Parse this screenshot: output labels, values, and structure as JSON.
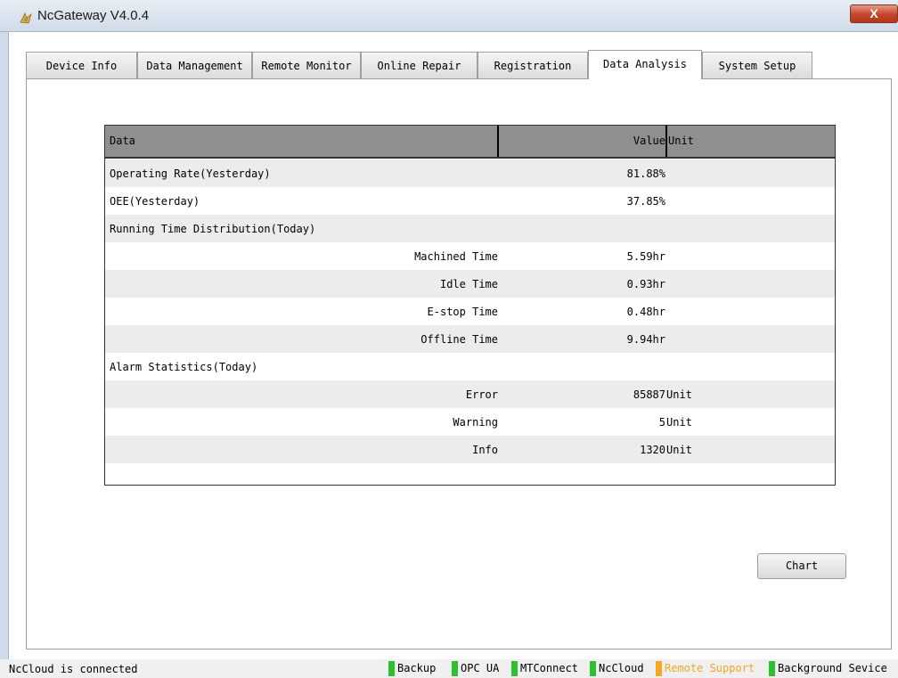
{
  "window": {
    "title": "NcGateway V4.0.4",
    "close_label": "X"
  },
  "tabs": [
    {
      "label": "Device Info"
    },
    {
      "label": "Data Management"
    },
    {
      "label": "Remote Monitor"
    },
    {
      "label": "Online Repair"
    },
    {
      "label": "Registration"
    },
    {
      "label": "Data Analysis",
      "active": true
    },
    {
      "label": "System Setup"
    }
  ],
  "table": {
    "headers": {
      "data": "Data",
      "value": "Value",
      "unit": "Unit"
    },
    "rows": [
      {
        "name": "Operating Rate(Yesterday)",
        "sub": "",
        "value": "81.88%",
        "unit": ""
      },
      {
        "name": "OEE(Yesterday)",
        "sub": "",
        "value": "37.85%",
        "unit": ""
      },
      {
        "name": "Running Time Distribution(Today)",
        "sub": "",
        "value": "",
        "unit": ""
      },
      {
        "name": "",
        "sub": "Machined Time",
        "value": "5.59hr",
        "unit": ""
      },
      {
        "name": "",
        "sub": "Idle Time",
        "value": "0.93hr",
        "unit": ""
      },
      {
        "name": "",
        "sub": "E-stop Time",
        "value": "0.48hr",
        "unit": ""
      },
      {
        "name": "",
        "sub": "Offline Time",
        "value": "9.94hr",
        "unit": ""
      },
      {
        "name": "Alarm Statistics(Today)",
        "sub": "",
        "value": "",
        "unit": ""
      },
      {
        "name": "",
        "sub": "Error",
        "value": "85887",
        "unit": "Unit"
      },
      {
        "name": "",
        "sub": "Warning",
        "value": "5",
        "unit": "Unit"
      },
      {
        "name": "",
        "sub": "Info",
        "value": "1320",
        "unit": "Unit"
      }
    ]
  },
  "chart_button": "Chart",
  "status": {
    "message": "NcCloud is connected",
    "services": [
      {
        "label": "Backup",
        "color": "#2fbf2f"
      },
      {
        "label": "OPC UA",
        "color": "#2fbf2f"
      },
      {
        "label": "MTConnect",
        "color": "#2fbf2f"
      },
      {
        "label": "NcCloud",
        "color": "#2fbf2f"
      },
      {
        "label": "Remote Support",
        "color": "#f5a623"
      },
      {
        "label": "Background Sevice",
        "color": "#2fbf2f"
      }
    ]
  }
}
